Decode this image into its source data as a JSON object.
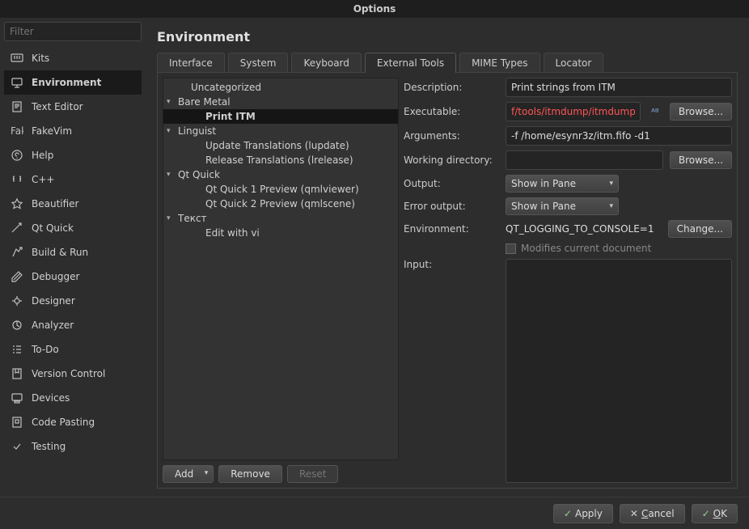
{
  "window": {
    "title": "Options"
  },
  "filter": {
    "placeholder": "Filter"
  },
  "sidebar": {
    "items": [
      {
        "label": "Kits"
      },
      {
        "label": "Environment"
      },
      {
        "label": "Text Editor"
      },
      {
        "label": "FakeVim"
      },
      {
        "label": "Help"
      },
      {
        "label": "C++"
      },
      {
        "label": "Beautifier"
      },
      {
        "label": "Qt Quick"
      },
      {
        "label": "Build & Run"
      },
      {
        "label": "Debugger"
      },
      {
        "label": "Designer"
      },
      {
        "label": "Analyzer"
      },
      {
        "label": "To-Do"
      },
      {
        "label": "Version Control"
      },
      {
        "label": "Devices"
      },
      {
        "label": "Code Pasting"
      },
      {
        "label": "Testing"
      }
    ],
    "selected_index": 1
  },
  "page": {
    "title": "Environment"
  },
  "tabs": {
    "items": [
      "Interface",
      "System",
      "Keyboard",
      "External Tools",
      "MIME Types",
      "Locator"
    ],
    "active_index": 3
  },
  "tree": {
    "rows": [
      {
        "label": "Uncategorized",
        "indent": 1,
        "expandable": false
      },
      {
        "label": "Bare Metal",
        "indent": 0,
        "expandable": true
      },
      {
        "label": "Print ITM",
        "indent": 2,
        "expandable": false,
        "selected": true
      },
      {
        "label": "Linguist",
        "indent": 0,
        "expandable": true
      },
      {
        "label": "Update Translations (lupdate)",
        "indent": 2,
        "expandable": false
      },
      {
        "label": "Release Translations (lrelease)",
        "indent": 2,
        "expandable": false
      },
      {
        "label": "Qt Quick",
        "indent": 0,
        "expandable": true
      },
      {
        "label": "Qt Quick 1 Preview (qmlviewer)",
        "indent": 2,
        "expandable": false
      },
      {
        "label": "Qt Quick 2 Preview (qmlscene)",
        "indent": 2,
        "expandable": false
      },
      {
        "label": "Текст",
        "indent": 0,
        "expandable": true
      },
      {
        "label": "Edit with vi",
        "indent": 2,
        "expandable": false
      }
    ],
    "buttons": {
      "add": "Add",
      "remove": "Remove",
      "reset": "Reset"
    }
  },
  "form": {
    "description": {
      "label": "Description:",
      "value": "Print strings from ITM"
    },
    "executable": {
      "label": "Executable:",
      "value": "f/tools/itmdump/itmdump",
      "browse": "Browse..."
    },
    "arguments": {
      "label": "Arguments:",
      "value": "-f /home/esynr3z/itm.fifo -d1"
    },
    "workdir": {
      "label": "Working directory:",
      "value": "",
      "browse": "Browse..."
    },
    "output": {
      "label": "Output:",
      "value": "Show in Pane"
    },
    "error_output": {
      "label": "Error output:",
      "value": "Show in Pane"
    },
    "environment": {
      "label": "Environment:",
      "value": "QT_LOGGING_TO_CONSOLE=1",
      "change": "Change..."
    },
    "modifies": {
      "label": "Modifies current document"
    },
    "input": {
      "label": "Input:"
    }
  },
  "footer": {
    "apply": "Apply",
    "cancel": "Cancel",
    "ok": "OK"
  }
}
